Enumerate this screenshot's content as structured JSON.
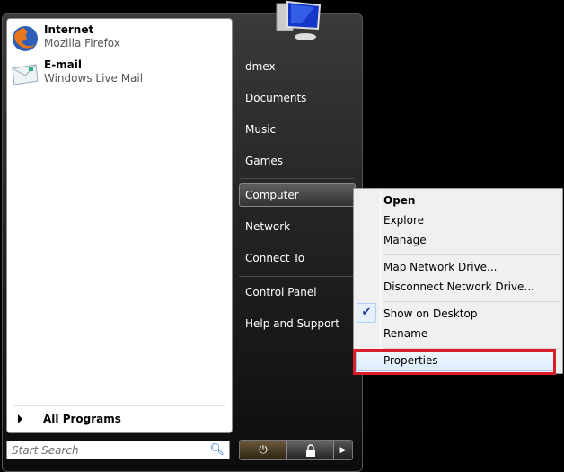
{
  "pinned": [
    {
      "title": "Internet",
      "subtitle": "Mozilla Firefox",
      "icon": "firefox-icon"
    },
    {
      "title": "E-mail",
      "subtitle": "Windows Live Mail",
      "icon": "mail-icon"
    }
  ],
  "all_programs": "All Programs",
  "search": {
    "placeholder": "Start Search"
  },
  "right": {
    "user": "dmex",
    "items": [
      "Documents",
      "Music",
      "Games",
      "Computer",
      "Network",
      "Connect To",
      "Control Panel",
      "Help and Support"
    ],
    "highlighted": "Computer"
  },
  "context_menu": {
    "items": [
      "Open",
      "Explore",
      "Manage",
      "Map Network Drive...",
      "Disconnect Network Drive...",
      "Show on Desktop",
      "Rename",
      "Properties"
    ],
    "default": "Open",
    "checked": "Show on Desktop",
    "highlighted": "Properties"
  },
  "colors": {
    "highlight_box": "#d9202a",
    "check": "#1a3c96"
  }
}
